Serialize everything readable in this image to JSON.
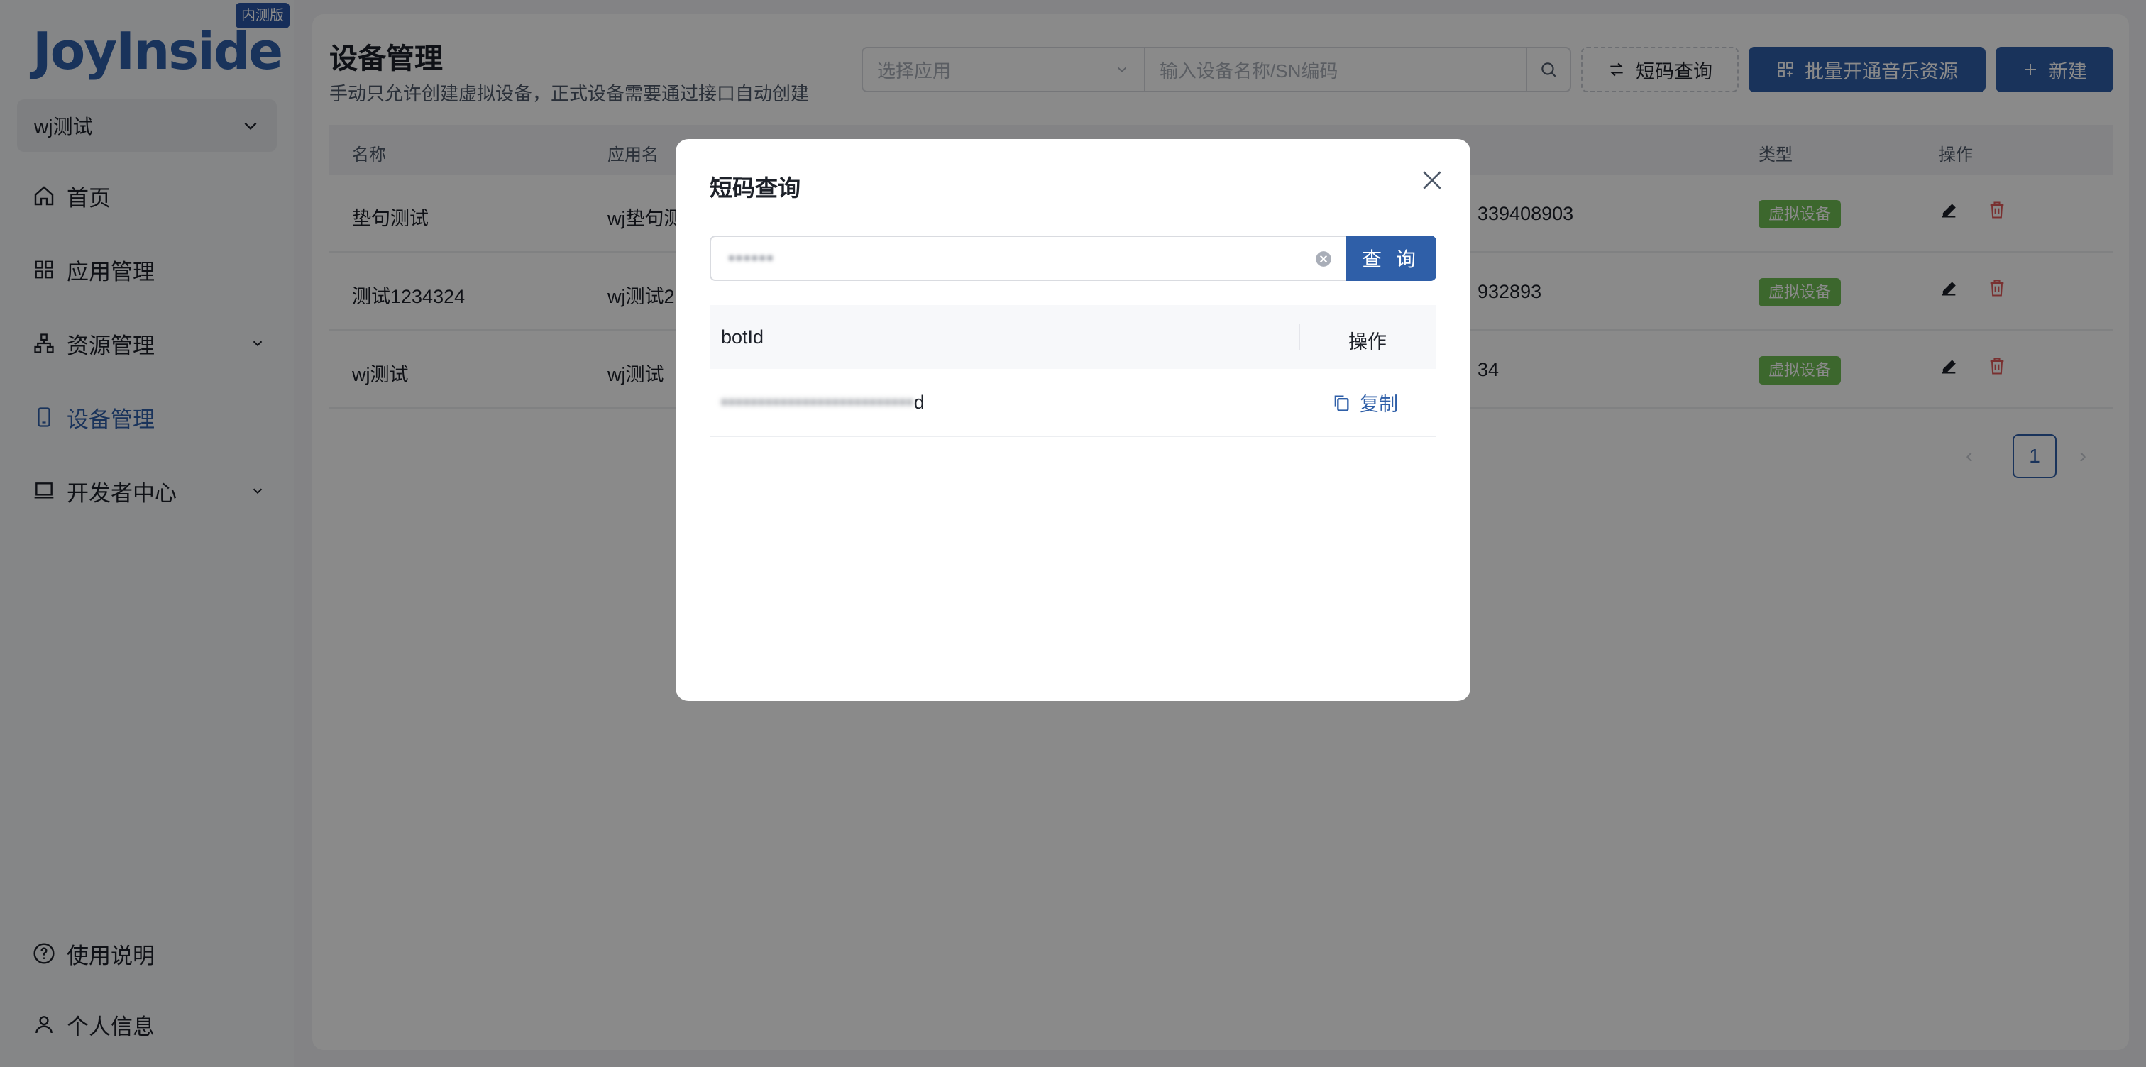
{
  "brand": {
    "logo": "JoyInside",
    "badge": "内测版"
  },
  "sidebar": {
    "app_select": "wj测试",
    "items": [
      {
        "label": "首页",
        "icon": "home-icon"
      },
      {
        "label": "应用管理",
        "icon": "apps-icon"
      },
      {
        "label": "资源管理",
        "icon": "resource-icon"
      },
      {
        "label": "设备管理",
        "icon": "device-icon"
      },
      {
        "label": "开发者中心",
        "icon": "laptop-icon"
      }
    ],
    "bottom": [
      {
        "label": "使用说明",
        "icon": "help-icon"
      },
      {
        "label": "个人信息",
        "icon": "user-icon"
      }
    ]
  },
  "header": {
    "title": "设备管理",
    "subtitle": "手动只允许创建虚拟设备，正式设备需要通过接口自动创建",
    "app_placeholder": "选择应用",
    "search_placeholder": "输入设备名称/SN编码",
    "short_code_label": "短码查询",
    "music_label": "批量开通音乐资源",
    "new_label": "新建"
  },
  "table": {
    "columns": [
      "名称",
      "应用名",
      "类型",
      "操作"
    ],
    "rows": [
      {
        "name": "垫句测试",
        "app": "wj垫句测",
        "sn": "339408903",
        "type": "虚拟设备"
      },
      {
        "name": "测试1234324",
        "app": "wj测试2",
        "sn": "932893",
        "type": "虚拟设备"
      },
      {
        "name": "wj测试",
        "app": "wj测试",
        "sn": "34",
        "type": "虚拟设备"
      }
    ]
  },
  "pagination": {
    "current": "1"
  },
  "modal": {
    "title": "短码查询",
    "input_value": "••••••",
    "query_label": "查 询",
    "col_botid": "botId",
    "col_action": "操作",
    "row_botid_hidden": "••••••••••••••••••••••••••",
    "row_botid_suffix": "d",
    "copy_label": "复制"
  },
  "colors": {
    "primary": "#2f5fa8",
    "tag": "#6fbe53",
    "delete": "#e05a5a"
  }
}
